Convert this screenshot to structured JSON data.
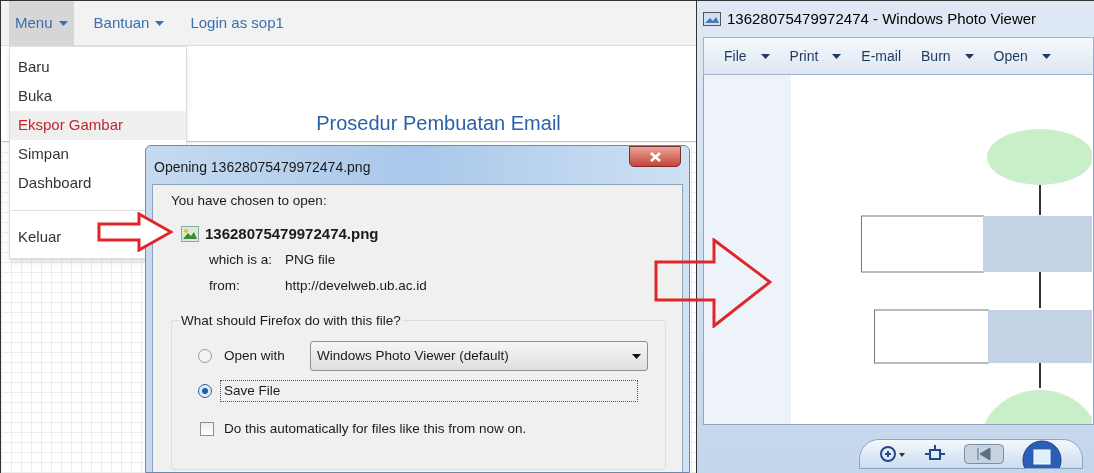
{
  "web_app": {
    "nav": [
      {
        "label": "Menu",
        "has_caret": true,
        "selected": true
      },
      {
        "label": "Bantuan",
        "has_caret": true,
        "selected": false
      },
      {
        "label": "Login as sop1",
        "has_caret": false,
        "selected": false
      }
    ],
    "menu_items": [
      {
        "label": "Baru",
        "selected": false
      },
      {
        "label": "Buka",
        "selected": false
      },
      {
        "label": "Ekspor Gambar",
        "selected": true
      },
      {
        "label": "Simpan",
        "selected": false
      },
      {
        "label": "Dashboard",
        "selected": false
      },
      {
        "kind": "divider"
      },
      {
        "label": "Keluar",
        "selected": false
      }
    ],
    "page_title": "Prosedur Pembuatan Email"
  },
  "dialog": {
    "title": "Opening 13628075479972474.png",
    "intro": "You have chosen to open:",
    "file_name": "13628075479972474.png",
    "type_label": "which is a:",
    "type_value": "PNG file",
    "from_label": "from:",
    "from_value": "http://develweb.ub.ac.id",
    "question": "What should Firefox do with this file?",
    "options": [
      {
        "kind": "radio",
        "label": "Open with",
        "selected": false,
        "app": "Windows Photo Viewer (default)"
      },
      {
        "kind": "radio",
        "label": "Save File",
        "selected": true,
        "focused": true
      }
    ],
    "auto_checkbox": {
      "label": "Do this automatically for files like this from now on.",
      "checked": false
    }
  },
  "photo_viewer": {
    "title": "13628075479972474 - Windows Photo Viewer",
    "toolbar": [
      {
        "label": "File",
        "has_menu": true
      },
      {
        "label": "Print",
        "has_menu": true
      },
      {
        "label": "E-mail",
        "has_menu": false
      },
      {
        "label": "Burn",
        "has_menu": true
      },
      {
        "label": "Open",
        "has_menu": true
      }
    ]
  }
}
